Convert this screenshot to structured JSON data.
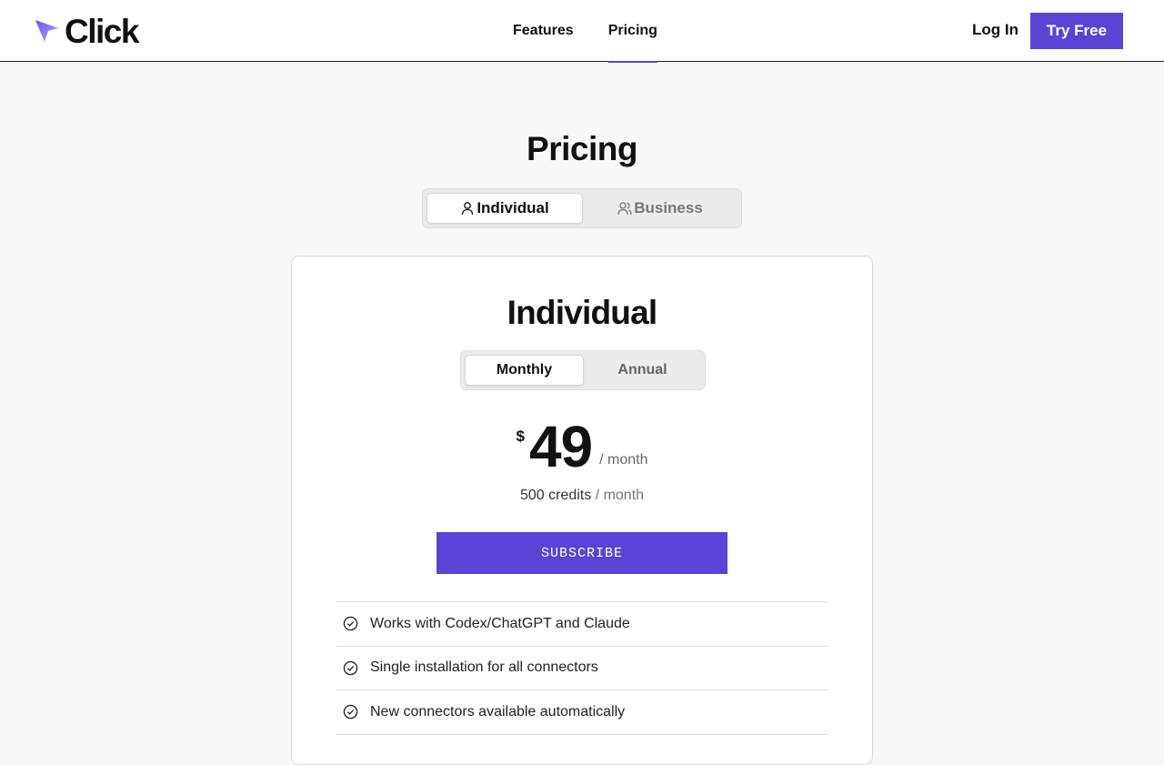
{
  "brand": {
    "name": "Click",
    "accent": "#5b43d6",
    "logo_icon": "cursor-arrow-icon"
  },
  "nav": {
    "items": [
      {
        "label": "Features",
        "active": false
      },
      {
        "label": "Pricing",
        "active": true
      }
    ],
    "login_label": "Log In",
    "cta_label": "Try Free"
  },
  "page": {
    "title": "Pricing"
  },
  "plan_type": {
    "options": [
      {
        "label": "Individual",
        "icon": "user-icon",
        "selected": true
      },
      {
        "label": "Business",
        "icon": "users-icon",
        "selected": false
      }
    ]
  },
  "card": {
    "title": "Individual",
    "billing": {
      "options": [
        {
          "label": "Monthly",
          "selected": true
        },
        {
          "label": "Annual",
          "selected": false
        }
      ]
    },
    "price": {
      "currency": "$",
      "amount": "49",
      "period": "/ month"
    },
    "credits": {
      "amount": "500 credits",
      "period": "/ month"
    },
    "subscribe_label": "SUBSCRIBE",
    "features": [
      {
        "text": "Works with Codex/ChatGPT and Claude",
        "icon": "check-circle-icon"
      },
      {
        "text": "Single installation for all connectors",
        "icon": "check-circle-icon"
      },
      {
        "text": "New connectors available automatically",
        "icon": "check-circle-icon"
      }
    ]
  }
}
